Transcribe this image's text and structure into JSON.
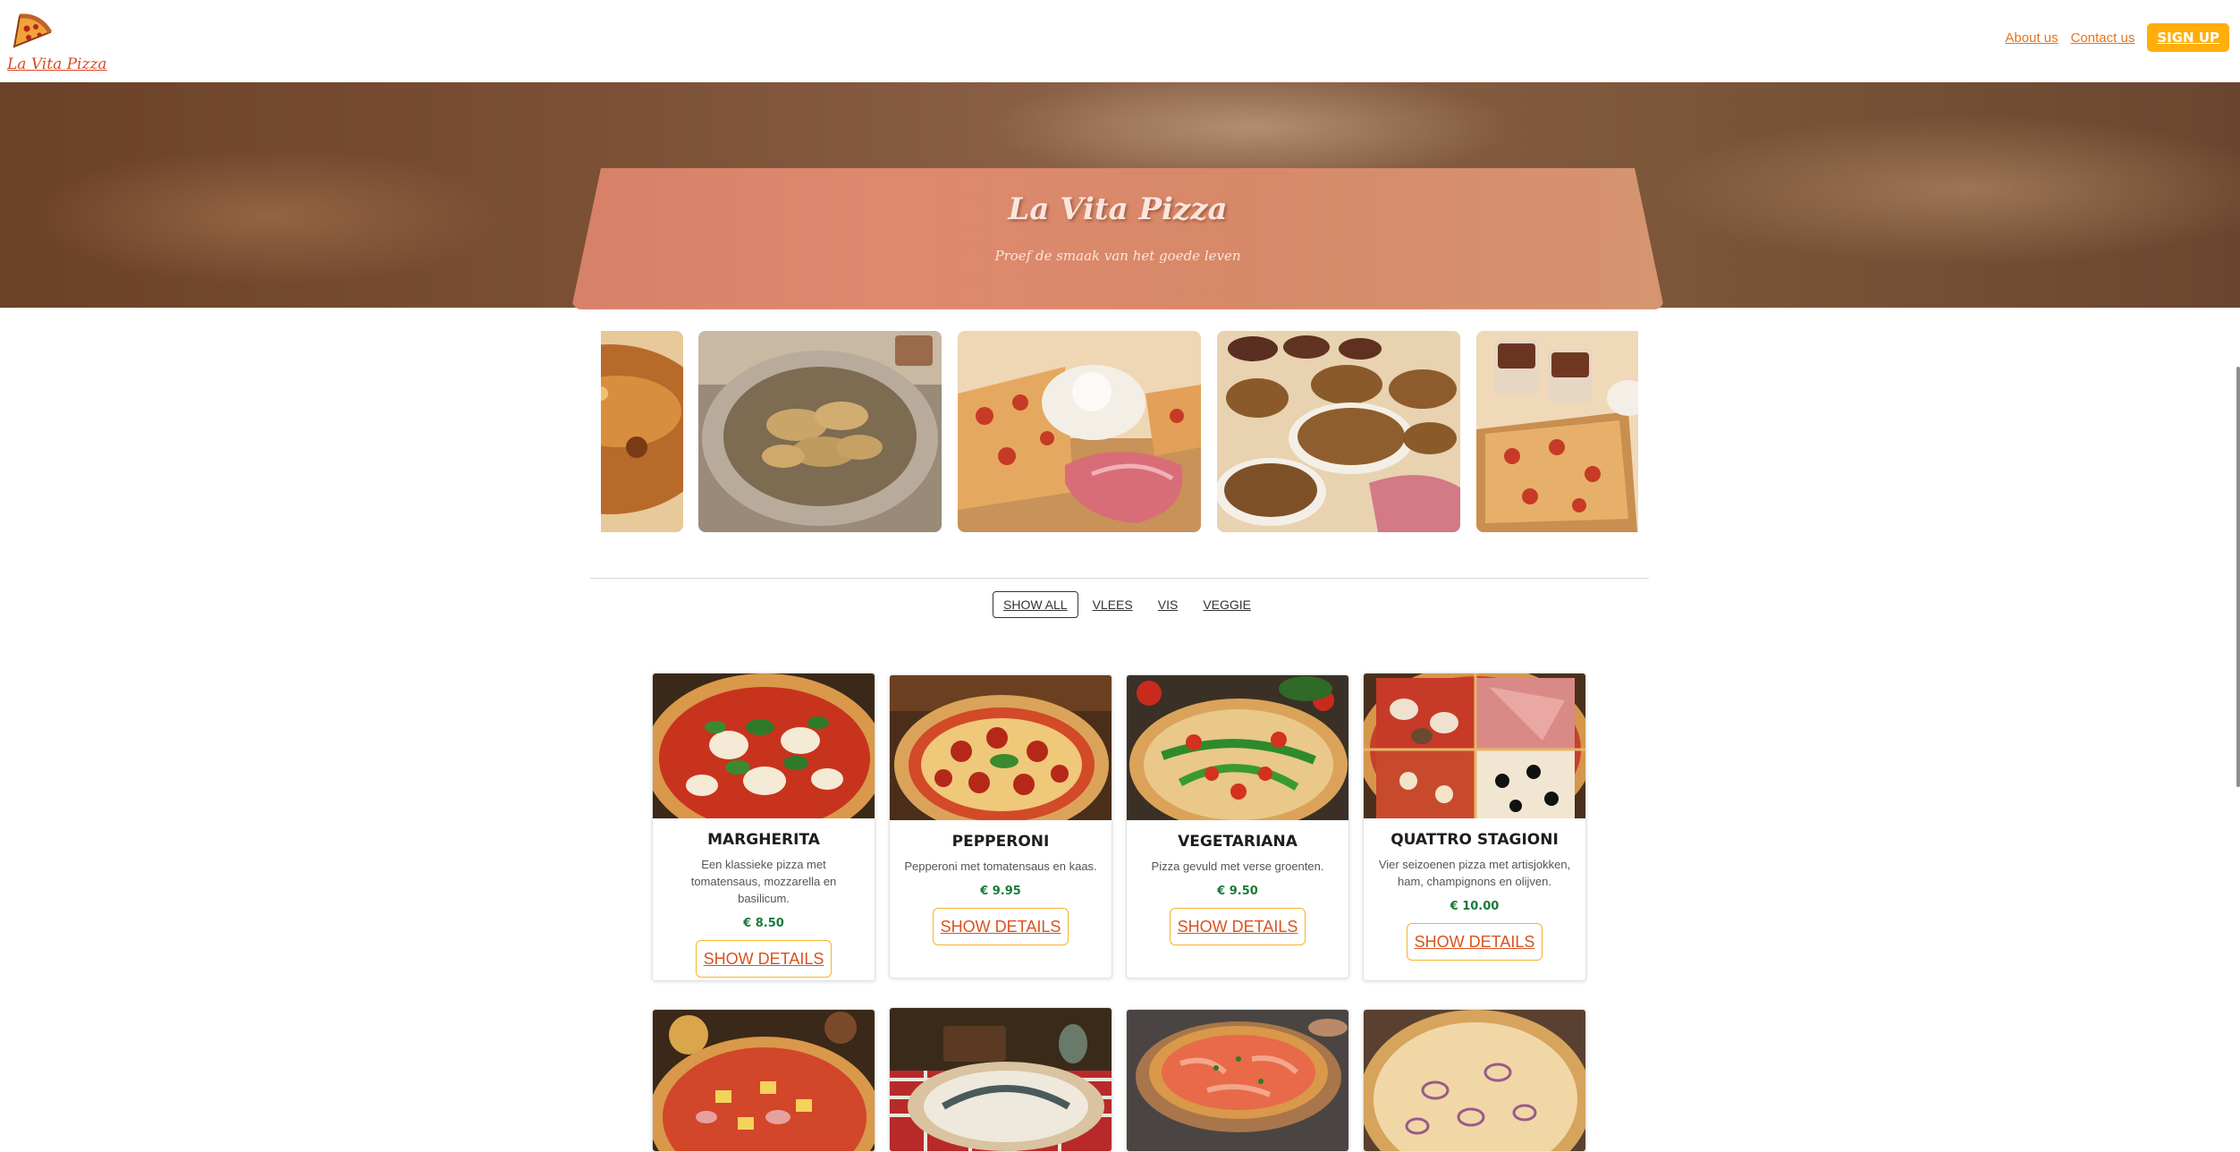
{
  "header": {
    "logo_text": "La Vita Pizza",
    "nav": [
      {
        "label": "About us"
      },
      {
        "label": "Contact us"
      }
    ],
    "signup_label": "SIGN UP"
  },
  "hero": {
    "title": "La Vita Pizza",
    "subtitle": "Proef de smaak van het goede leven"
  },
  "carousel": {
    "slides": [
      "baked-dish-image",
      "ravioli-image",
      "pizza-burrata-ham-image",
      "grain-bowls-ham-image",
      "pizza-dessert-image"
    ]
  },
  "filters": [
    {
      "label": "SHOW ALL",
      "active": true
    },
    {
      "label": "VLEES",
      "active": false
    },
    {
      "label": "VIS",
      "active": false
    },
    {
      "label": "VEGGIE",
      "active": false
    }
  ],
  "products": [
    {
      "name": "MARGHERITA",
      "description": "Een klassieke pizza met tomatensaus, mozzarella en basilicum.",
      "price": "€ 8.50",
      "button": "SHOW DETAILS"
    },
    {
      "name": "PEPPERONI",
      "description": "Pepperoni met tomatensaus en kaas.",
      "price": "€ 9.95",
      "button": "SHOW DETAILS"
    },
    {
      "name": "VEGETARIANA",
      "description": "Pizza gevuld met verse groenten.",
      "price": "€ 9.50",
      "button": "SHOW DETAILS"
    },
    {
      "name": "QUATTRO STAGIONI",
      "description": "Vier seizoenen pizza met artisjokken, ham, champignons en olijven.",
      "price": "€ 10.00",
      "button": "SHOW DETAILS"
    }
  ],
  "colors": {
    "accent": "#ffae0b",
    "link": "#e6731a",
    "price": "#1a7a3a",
    "button_text": "#d9531e"
  }
}
